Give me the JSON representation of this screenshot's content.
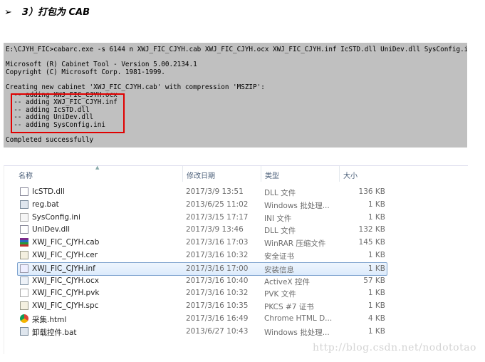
{
  "heading": {
    "bullet": "➢",
    "text": "3）打包为 CAB"
  },
  "console": {
    "lines": [
      "E:\\CJYH_FIC>cabarc.exe -s 6144 n XWJ_FIC_CJYH.cab XWJ_FIC_CJYH.ocx XWJ_FIC_CJYH.inf IcSTD.dll UniDev.dll SysConfig.ini",
      "",
      "Microsoft (R) Cabinet Tool - Version 5.00.2134.1",
      "Copyright (C) Microsoft Corp. 1981-1999.",
      "",
      "Creating new cabinet 'XWJ_FIC_CJYH.cab' with compression 'MSZIP':",
      "  -- adding XWJ_FIC_CJYH.ocx",
      "  -- adding XWJ_FIC_CJYH.inf",
      "  -- adding IcSTD.dll",
      "  -- adding UniDev.dll",
      "  -- adding SysConfig.ini",
      "",
      "Completed successfully"
    ],
    "highlight_color": "#e00000"
  },
  "explorer": {
    "columns": [
      "名称",
      "修改日期",
      "类型",
      "大小"
    ],
    "files": [
      {
        "name": "IcSTD.dll",
        "date": "2017/3/9 13:51",
        "type": "DLL 文件",
        "size": "136 KB",
        "icon": "dll-icon"
      },
      {
        "name": "reg.bat",
        "date": "2013/6/25 11:02",
        "type": "Windows 批处理...",
        "size": "1 KB",
        "icon": "bat-icon"
      },
      {
        "name": "SysConfig.ini",
        "date": "2017/3/15 17:17",
        "type": "INI 文件",
        "size": "1 KB",
        "icon": "ini-icon"
      },
      {
        "name": "UniDev.dll",
        "date": "2017/3/9 13:46",
        "type": "DLL 文件",
        "size": "132 KB",
        "icon": "dll-icon"
      },
      {
        "name": "XWJ_FIC_CJYH.cab",
        "date": "2017/3/16 17:03",
        "type": "WinRAR 压缩文件",
        "size": "145 KB",
        "icon": "winrar-icon"
      },
      {
        "name": "XWJ_FIC_CJYH.cer",
        "date": "2017/3/16 10:32",
        "type": "安全证书",
        "size": "1 KB",
        "icon": "certificate-icon"
      },
      {
        "name": "XWJ_FIC_CJYH.inf",
        "date": "2017/3/16 17:00",
        "type": "安装信息",
        "size": "1 KB",
        "icon": "inf-icon",
        "selected": true
      },
      {
        "name": "XWJ_FIC_CJYH.ocx",
        "date": "2017/3/16 10:40",
        "type": "ActiveX 控件",
        "size": "57 KB",
        "icon": "ocx-icon"
      },
      {
        "name": "XWJ_FIC_CJYH.pvk",
        "date": "2017/3/16 10:32",
        "type": "PVK 文件",
        "size": "1 KB",
        "icon": "file-icon"
      },
      {
        "name": "XWJ_FIC_CJYH.spc",
        "date": "2017/3/16 10:35",
        "type": "PKCS #7 证书",
        "size": "1 KB",
        "icon": "certificate-icon"
      },
      {
        "name": "采集.html",
        "date": "2017/3/16 16:49",
        "type": "Chrome HTML D...",
        "size": "4 KB",
        "icon": "chrome-icon"
      },
      {
        "name": "卸载控件.bat",
        "date": "2013/6/27 10:43",
        "type": "Windows 批处理...",
        "size": "1 KB",
        "icon": "bat-icon"
      }
    ]
  },
  "watermark": "http://blog.csdn.net/nodototao"
}
